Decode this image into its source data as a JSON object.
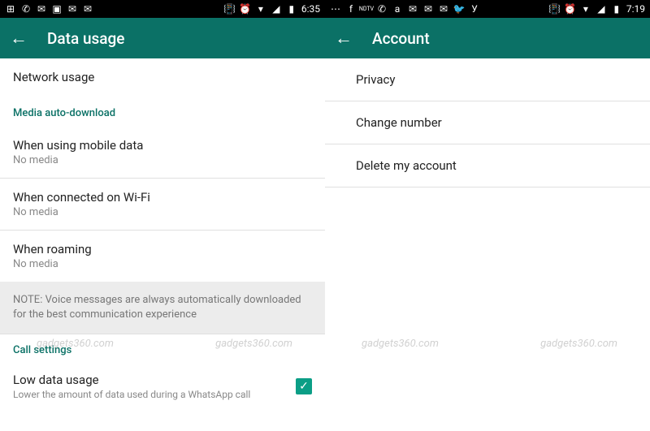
{
  "left": {
    "statusTime": "6:35",
    "appBar": {
      "title": "Data usage"
    },
    "items": {
      "networkUsage": "Network usage",
      "mediaHeader": "Media auto-download",
      "mobileData": {
        "title": "When using mobile data",
        "sub": "No media"
      },
      "wifi": {
        "title": "When connected on Wi-Fi",
        "sub": "No media"
      },
      "roaming": {
        "title": "When roaming",
        "sub": "No media"
      },
      "note": "NOTE: Voice messages are always automatically downloaded for the best communication experience",
      "callHeader": "Call settings",
      "lowData": {
        "title": "Low data usage",
        "sub": "Lower the amount of data used during a WhatsApp call",
        "checked": true
      }
    },
    "watermark": "gadgets360.com"
  },
  "right": {
    "statusTime": "7:19",
    "appBar": {
      "title": "Account"
    },
    "items": {
      "privacy": "Privacy",
      "changeNumber": "Change number",
      "deleteAccount": "Delete my account"
    },
    "watermark": "gadgets360.com"
  }
}
